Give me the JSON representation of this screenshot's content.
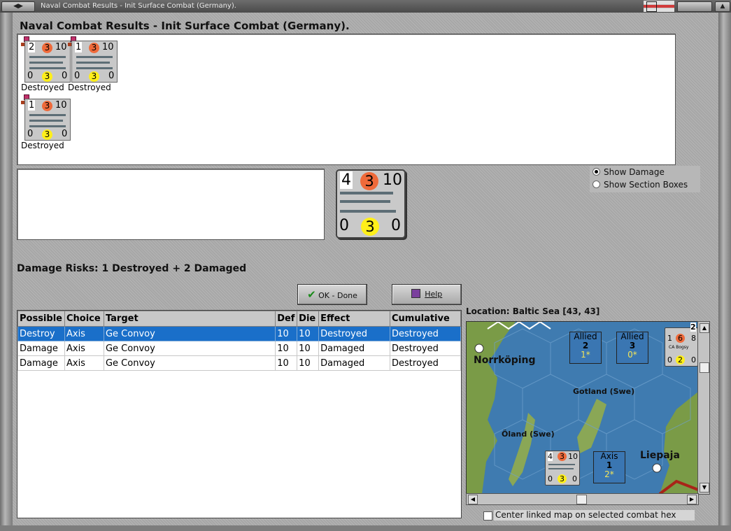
{
  "window": {
    "title": "Naval Combat Results - Init Surface Combat (Germany)."
  },
  "heading": "Naval Combat Results - Init Surface Combat (Germany).",
  "units": [
    {
      "top_left": "2",
      "top_mid": "3",
      "top_right": "10",
      "bot_left": "0",
      "bot_mid": "3",
      "bot_right": "0",
      "status": "Destroyed"
    },
    {
      "top_left": "1",
      "top_mid": "3",
      "top_right": "10",
      "bot_left": "0",
      "bot_mid": "3",
      "bot_right": "0",
      "status": "Destroyed"
    },
    {
      "top_left": "1",
      "top_mid": "3",
      "top_right": "10",
      "bot_left": "0",
      "bot_mid": "3",
      "bot_right": "0",
      "status": "Destroyed"
    }
  ],
  "selected_unit": {
    "top_left": "4",
    "top_mid": "3",
    "top_right": "10",
    "bot_left": "0",
    "bot_mid": "3",
    "bot_right": "0"
  },
  "options": {
    "show_damage": "Show Damage",
    "show_sections": "Show Section Boxes",
    "selected": "show_damage"
  },
  "damage_risks": "Damage Risks: 1 Destroyed + 2 Damaged",
  "buttons": {
    "ok": "OK - Done",
    "help": "Help"
  },
  "table": {
    "headers": [
      "Possible",
      "Choice",
      "Target",
      "Def",
      "Die",
      "Effect",
      "Cumulative"
    ],
    "rows": [
      [
        "Destroy",
        "Axis",
        "Ge Convoy",
        "10",
        "10",
        "Destroyed",
        "Destroyed"
      ],
      [
        "Damage",
        "Axis",
        "Ge Convoy",
        "10",
        "10",
        "Damaged",
        "Destroyed"
      ],
      [
        "Damage",
        "Axis",
        "Ge Convoy",
        "10",
        "10",
        "Damaged",
        "Destroyed"
      ]
    ],
    "selected_row": 0
  },
  "location": "Location:  Baltic Sea [43, 43]",
  "map": {
    "labels": {
      "norrkoping": "Norrköping",
      "gotland": "Gotland (Swe)",
      "oland": "Öland (Swe)",
      "liepaja": "Liepaja"
    },
    "allied_box_1": {
      "title": "Allied",
      "value": "2",
      "sub": "1*"
    },
    "allied_box_2": {
      "title": "Allied",
      "value": "3",
      "sub": "0*"
    },
    "axis_box": {
      "title": "Axis",
      "value": "1",
      "sub": "2*"
    },
    "map_counter": {
      "top_left": "4",
      "top_mid": "3",
      "top_right": "10",
      "bot_left": "0",
      "bot_mid": "3",
      "bot_right": "0"
    },
    "corner_counter": {
      "stack": "2",
      "top_left": "1",
      "top_mid": "6",
      "top_right": "8",
      "label": "CA Bogsy",
      "bot_left": "0",
      "bot_mid": "2",
      "bot_right": "0"
    }
  },
  "center_checkbox": "Center linked map on selected combat hex",
  "colors": {
    "selection": "#1a6fc9",
    "orange_circle": "#ef6a3a",
    "yellow_circle": "#ffef1a",
    "sea": "#3f7bb0",
    "land": "#7a9b47"
  }
}
